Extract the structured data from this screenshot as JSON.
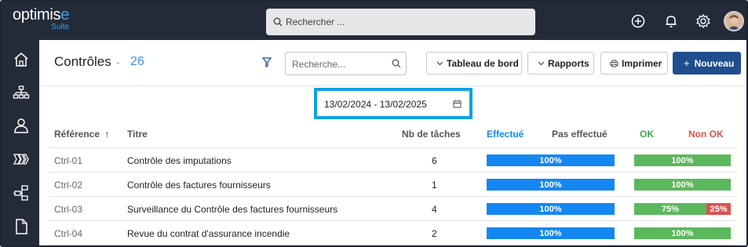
{
  "app": {
    "logo_main": "optimis",
    "logo_accent": "e",
    "logo_sub": "Suite"
  },
  "topbar": {
    "search_placeholder": "Rechercher ...",
    "icons": [
      "add-icon",
      "bell-icon",
      "settings-icon"
    ]
  },
  "sidebar": {
    "items": [
      "home-icon",
      "org-chart-icon",
      "user-icon",
      "process-icon",
      "hierarchy-icon",
      "document-icon"
    ]
  },
  "page": {
    "title": "Contrôles",
    "separator": "-",
    "count": "26",
    "search_placeholder": "Recherche...",
    "buttons": {
      "dashboard": "Tableau de bord",
      "reports": "Rapports",
      "print": "Imprimer",
      "new": "Nouveau"
    },
    "date_range": "13/02/2024 - 13/02/2025"
  },
  "table": {
    "headers": {
      "reference": "Référence",
      "title": "Titre",
      "tasks": "Nb de tâches",
      "done": "Effectué",
      "not_done": "Pas effectué",
      "ok": "OK",
      "not_ok": "Non OK"
    },
    "rows": [
      {
        "ref": "Ctrl-01",
        "title": "Contrôle des imputations",
        "tasks": "6",
        "done_label": "100%",
        "done_pct": 100,
        "ok_label": "100%",
        "ok_pct": 100,
        "nok_label": "",
        "nok_pct": 0
      },
      {
        "ref": "Ctrl-02",
        "title": "Contrôle des factures fournisseurs",
        "tasks": "1",
        "done_label": "100%",
        "done_pct": 100,
        "ok_label": "100%",
        "ok_pct": 100,
        "nok_label": "",
        "nok_pct": 0
      },
      {
        "ref": "Ctrl-03",
        "title": "Surveillance du Contrôle des factures fournisseurs",
        "tasks": "4",
        "done_label": "100%",
        "done_pct": 100,
        "ok_label": "75%",
        "ok_pct": 75,
        "nok_label": "25%",
        "nok_pct": 25
      },
      {
        "ref": "Ctrl-04",
        "title": "Revue du contrat d'assurance incendie",
        "tasks": "2",
        "done_label": "100%",
        "done_pct": 100,
        "ok_label": "100%",
        "ok_pct": 100,
        "nok_label": "",
        "nok_pct": 0
      }
    ]
  },
  "colors": {
    "done": "#1487f2",
    "ok": "#5cb85c",
    "not_ok": "#d9534f",
    "header_done": "#1487f2",
    "header_ok": "#3fa34a",
    "header_not_ok": "#d9534f"
  }
}
